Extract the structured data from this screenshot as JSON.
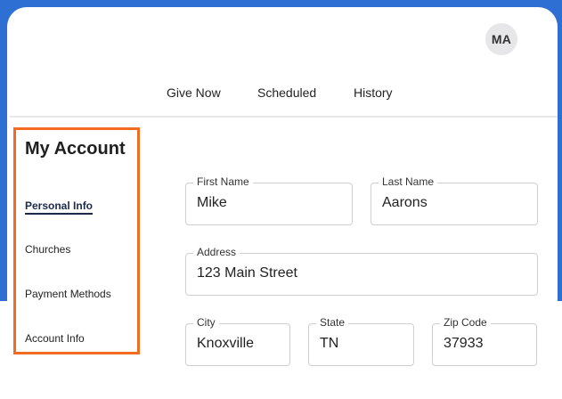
{
  "header": {
    "avatar_initials": "MA"
  },
  "nav": {
    "tabs": [
      {
        "label": "Give Now"
      },
      {
        "label": "Scheduled"
      },
      {
        "label": "History"
      }
    ]
  },
  "sidebar": {
    "title": "My Account",
    "items": [
      {
        "label": "Personal Info",
        "active": true
      },
      {
        "label": "Churches",
        "active": false
      },
      {
        "label": "Payment Methods",
        "active": false
      },
      {
        "label": "Account Info",
        "active": false
      }
    ]
  },
  "form": {
    "first_name": {
      "label": "First Name",
      "value": "Mike"
    },
    "last_name": {
      "label": "Last Name",
      "value": "Aarons"
    },
    "address": {
      "label": "Address",
      "value": "123 Main Street"
    },
    "city": {
      "label": "City",
      "value": "Knoxville"
    },
    "state": {
      "label": "State",
      "value": "TN"
    },
    "zip": {
      "label": "Zip Code",
      "value": "37933"
    }
  },
  "colors": {
    "brand_blue": "#2d6fd2",
    "highlight_orange": "#f26b21",
    "active_underline": "#1b2a4b"
  }
}
